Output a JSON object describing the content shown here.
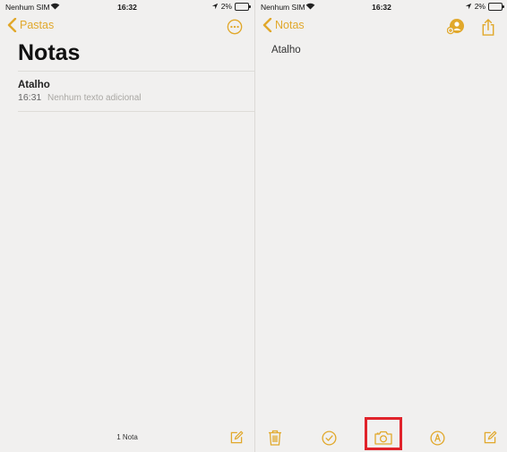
{
  "left": {
    "status": {
      "carrier": "Nenhum SIM",
      "time": "16:32",
      "battery": "2%"
    },
    "nav": {
      "back_label": "Pastas",
      "more_icon": "ellipsis-circle-icon"
    },
    "title": "Notas",
    "notes": [
      {
        "title": "Atalho",
        "time": "16:31",
        "snippet": "Nenhum texto adicional"
      }
    ],
    "footer": {
      "count": "1 Nota",
      "compose_icon": "compose-icon"
    }
  },
  "right": {
    "status": {
      "carrier": "Nenhum SIM",
      "time": "16:32",
      "battery": "2%"
    },
    "nav": {
      "back_label": "Notas",
      "collab_icon": "add-person-icon",
      "share_icon": "share-icon"
    },
    "body_text": "Atalho",
    "toolbar": [
      "trash-icon",
      "checklist-icon",
      "camera-icon",
      "markup-icon",
      "compose-icon"
    ],
    "highlighted": "camera-icon"
  },
  "colors": {
    "accent": "#e1a82b",
    "highlight": "#e0232b",
    "background": "#f1f0ef"
  }
}
